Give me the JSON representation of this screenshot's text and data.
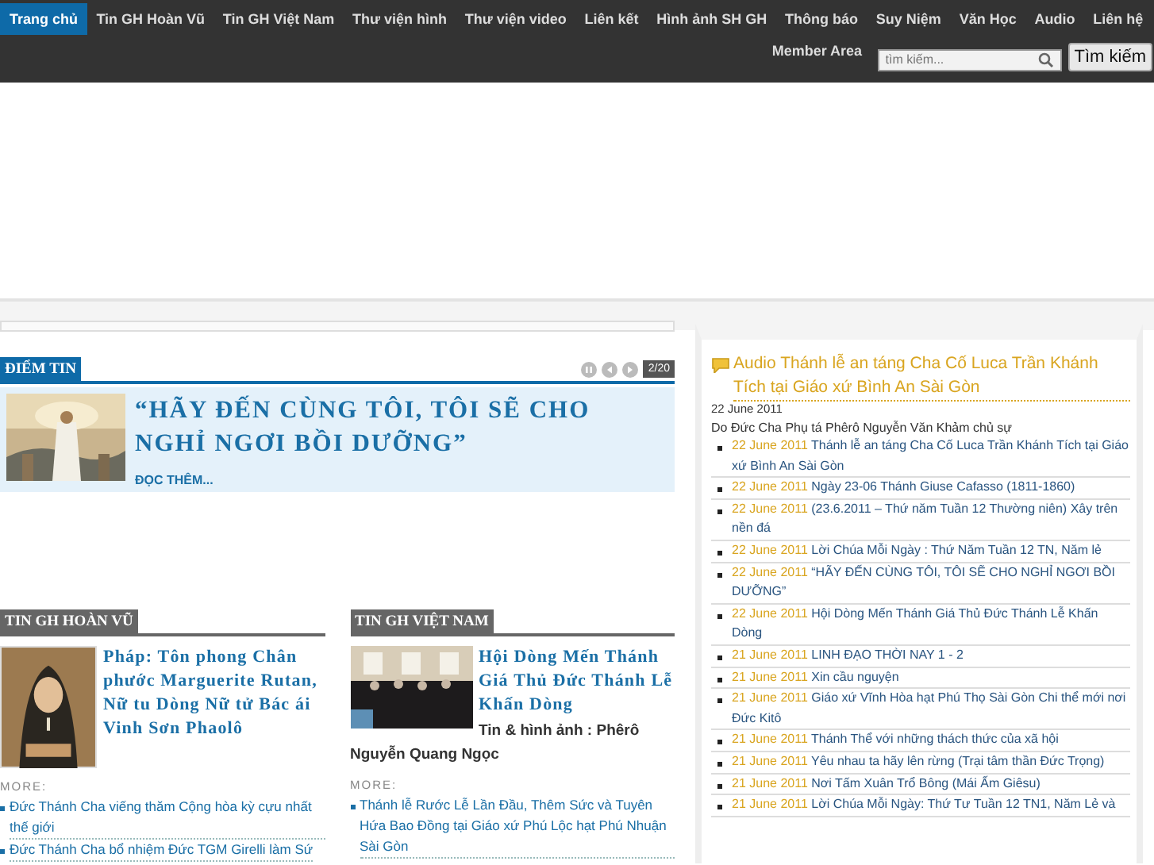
{
  "nav": {
    "items": [
      {
        "label": "Trang chủ",
        "selected": true
      },
      {
        "label": "Tin GH Hoàn Vũ",
        "selected": false
      },
      {
        "label": "Tin GH Việt Nam",
        "selected": false
      },
      {
        "label": "Thư viện hình",
        "selected": false
      },
      {
        "label": "Thư viện video",
        "selected": false
      },
      {
        "label": "Liên kết",
        "selected": false
      },
      {
        "label": "Hình ảnh SH GH",
        "selected": false
      },
      {
        "label": "Thông báo",
        "selected": false
      },
      {
        "label": "Suy Niệm",
        "selected": false
      },
      {
        "label": "Văn Học",
        "selected": false
      },
      {
        "label": "Audio",
        "selected": false
      },
      {
        "label": "Liên hệ",
        "selected": false
      }
    ],
    "member": "Member Area",
    "search": {
      "placeholder": "tìm kiếm...",
      "button": "Tìm kiếm"
    }
  },
  "featured": {
    "heading": "ĐIỂM TIN",
    "counter": "2/20",
    "title": "“HÃY ĐẾN CÙNG TÔI, TÔI SẼ CHO NGHỈ NGƠI BỒI DƯỠNG”",
    "more": "ĐỌC THÊM..."
  },
  "sections": [
    {
      "heading": "TIN GH HOÀN VŨ",
      "title": "Pháp: Tôn phong Chân phước Marguerite Rutan, Nữ tu Dòng Nữ tử Bác ái Vinh Sơn Phaolô",
      "more": "MORE:",
      "links": [
        "Đức Thánh Cha viếng thăm Cộng hòa kỳ cựu nhất thế giới",
        "Đức Thánh Cha bổ nhiệm Đức TGM Girelli làm Sứ"
      ]
    },
    {
      "heading": "TIN GH VIỆT NAM",
      "title": "Hội Dòng Mến Thánh Giá Thủ Đức Thánh Lễ Khấn Dòng",
      "byline": "Tin & hình ảnh : Phêrô Nguyễn Quang Ngọc",
      "more": "MORE:",
      "links": [
        "Thánh lễ Rước Lễ Lần Đầu, Thêm Sức và Tuyên Hứa Bao Đồng tại Giáo xứ Phú Lộc hạt Phú Nhuận Sài Gòn"
      ]
    }
  ],
  "audio": {
    "title": "Audio Thánh lễ an táng Cha Cố Luca Trần Khánh Tích tại Giáo xứ Bình An Sài Gòn",
    "date": "22 June 2011",
    "summary": "Do Đức Cha Phụ tá Phêrô Nguyễn Văn Khảm chủ sự",
    "items": [
      {
        "date": "22 June 2011",
        "title": "Thánh lễ an táng Cha Cố Luca Trần Khánh Tích tại Giáo xứ Bình An Sài Gòn"
      },
      {
        "date": "22 June 2011",
        "title": "Ngày 23-06 Thánh Giuse Cafasso (1811-1860)"
      },
      {
        "date": "22 June 2011",
        "title": "(23.6.2011 – Thứ năm Tuần 12 Thường niên) Xây trên nền đá"
      },
      {
        "date": "22 June 2011",
        "title": "Lời Chúa Mỗi Ngày : Thứ Năm Tuần 12 TN, Năm lẻ"
      },
      {
        "date": "22 June 2011",
        "title": "“HÃY ĐẾN CÙNG TÔI, TÔI SẼ CHO NGHỈ NGƠI BỒI DƯỠNG”"
      },
      {
        "date": "22 June 2011",
        "title": "Hội Dòng Mến Thánh Giá Thủ Đức Thánh Lễ Khấn Dòng"
      },
      {
        "date": "21 June 2011",
        "title": "LINH ĐẠO THỜI NAY 1 - 2"
      },
      {
        "date": "21 June 2011",
        "title": "Xin cầu nguyện"
      },
      {
        "date": "21 June 2011",
        "title": "Giáo xứ Vĩnh Hòa hạt Phú Thọ Sài Gòn Chi thể mới nơi Đức Kitô"
      },
      {
        "date": "21 June 2011",
        "title": "Thánh Thể với những thách thức của xã hội"
      },
      {
        "date": "21 June 2011",
        "title": "Yêu nhau ta hãy lên rừng (Trại tâm thần Đức Trọng)"
      },
      {
        "date": "21 June 2011",
        "title": "Nơi Tấm Xuân Trổ Bông (Mái Ấm Giêsu)"
      },
      {
        "date": "21 June 2011",
        "title": "Lời Chúa Mỗi Ngày: Thứ Tư Tuần 12 TN1, Năm Lẻ và"
      }
    ]
  }
}
